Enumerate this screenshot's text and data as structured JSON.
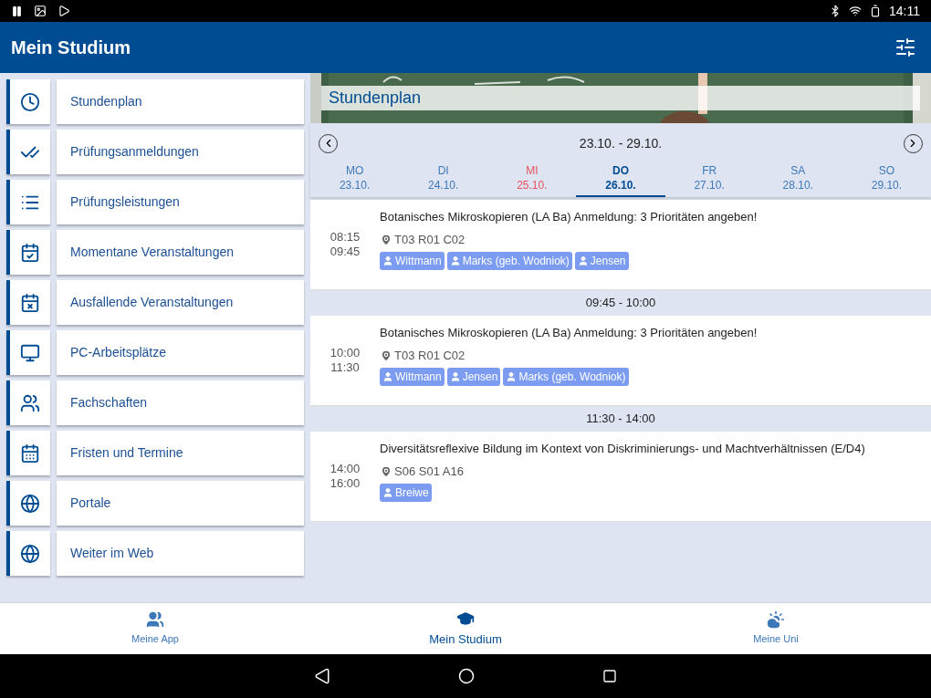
{
  "status_bar": {
    "time": "14:11"
  },
  "app_bar": {
    "title": "Mein Studium"
  },
  "menu": [
    {
      "label": "Stundenplan"
    },
    {
      "label": "Prüfungsanmeldungen"
    },
    {
      "label": "Prüfungsleistungen"
    },
    {
      "label": "Momentane Veranstaltungen"
    },
    {
      "label": "Ausfallende Veranstaltungen"
    },
    {
      "label": "PC-Arbeitsplätze"
    },
    {
      "label": "Fachschaften"
    },
    {
      "label": "Fristen und Termine"
    },
    {
      "label": "Portale"
    },
    {
      "label": "Weiter im Web"
    }
  ],
  "schedule": {
    "title": "Stundenplan",
    "week": "23.10. - 29.10.",
    "days": [
      {
        "name": "MO",
        "date": "23.10.",
        "selected": false,
        "today": false
      },
      {
        "name": "DI",
        "date": "24.10.",
        "selected": false,
        "today": false
      },
      {
        "name": "MI",
        "date": "25.10.",
        "selected": false,
        "today": true
      },
      {
        "name": "DO",
        "date": "26.10.",
        "selected": true,
        "today": false
      },
      {
        "name": "FR",
        "date": "27.10.",
        "selected": false,
        "today": false
      },
      {
        "name": "SA",
        "date": "28.10.",
        "selected": false,
        "today": false
      },
      {
        "name": "SO",
        "date": "29.10.",
        "selected": false,
        "today": false
      }
    ],
    "entries": [
      {
        "kind": "event",
        "start": "08:15",
        "end": "09:45",
        "title": "Botanisches Mikroskopieren (LA Ba) Anmeldung: 3 Prioritäten angeben!",
        "room": "T03 R01 C02",
        "people": [
          "Wittmann",
          "Marks (geb. Wodniok)",
          "Jensen"
        ]
      },
      {
        "kind": "gap",
        "label": "09:45 - 10:00"
      },
      {
        "kind": "event",
        "start": "10:00",
        "end": "11:30",
        "title": "Botanisches Mikroskopieren (LA Ba) Anmeldung: 3 Prioritäten angeben!",
        "room": "T03 R01 C02",
        "people": [
          "Wittmann",
          "Jensen",
          "Marks (geb. Wodniok)"
        ]
      },
      {
        "kind": "gap",
        "label": "11:30 - 14:00"
      },
      {
        "kind": "event",
        "start": "14:00",
        "end": "16:00",
        "title": "Diversitätsreflexive Bildung im Kontext von Diskriminierungs- und Machtverhältnissen (E/D4)",
        "room": "S06 S01 A16",
        "people": [
          "Breiwe"
        ]
      }
    ]
  },
  "bottom_nav": [
    {
      "label": "Meine App",
      "selected": false
    },
    {
      "label": "Mein Studium",
      "selected": true
    },
    {
      "label": "Meine Uni",
      "selected": false
    }
  ]
}
